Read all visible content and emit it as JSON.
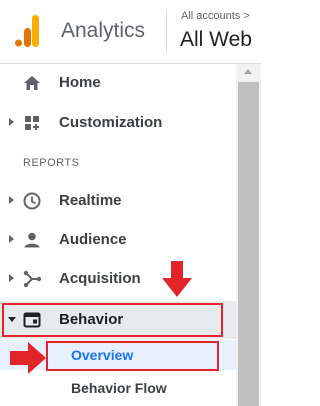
{
  "header": {
    "app_title": "Analytics",
    "account_breadcrumb": "All accounts >",
    "property_name": "All Web"
  },
  "nav": {
    "home": "Home",
    "customization": "Customization",
    "reports_heading": "REPORTS",
    "realtime": "Realtime",
    "audience": "Audience",
    "acquisition": "Acquisition",
    "behavior": "Behavior",
    "behavior_children": {
      "overview": "Overview",
      "behavior_flow": "Behavior Flow"
    }
  },
  "colors": {
    "accent_blue": "#1a73e8",
    "annotation_red": "#e3242b",
    "logo_orange": "#f9ab00",
    "logo_dark_orange": "#e37400",
    "selected_bg": "#e8f0fe"
  },
  "icons": [
    "analytics-logo-icon",
    "home-icon",
    "customization-icon",
    "clock-icon",
    "person-icon",
    "acquisition-icon",
    "behavior-icon"
  ]
}
